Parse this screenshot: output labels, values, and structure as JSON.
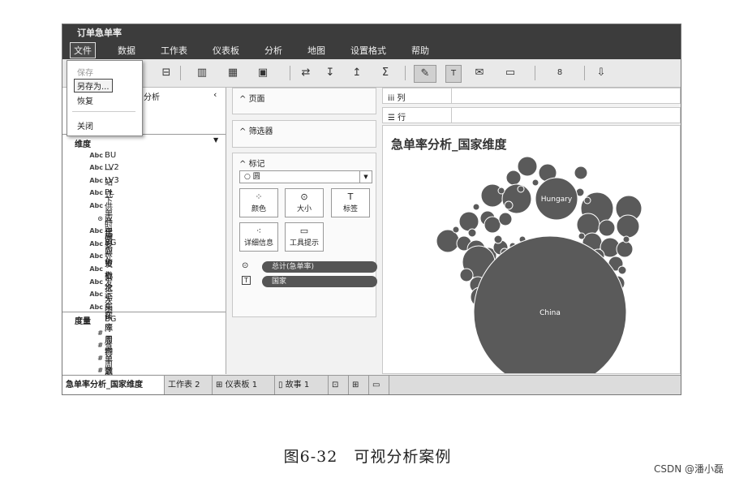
{
  "app": {
    "title": "订单急单率",
    "menus": [
      "文件",
      "数据",
      "工作表",
      "仪表板",
      "分析",
      "地图",
      "设置格式",
      "帮助"
    ]
  },
  "file_menu": {
    "items": [
      {
        "label": "保存",
        "state": "disabled"
      },
      {
        "label": "另存为...",
        "state": "highlighted"
      },
      {
        "label": "恢复",
        "state": "normal"
      },
      {
        "label": "关闭",
        "state": "normal"
      }
    ]
  },
  "toolbar": {
    "icons": [
      "datasource-icon",
      "new-sheet-icon",
      "duplicate-icon",
      "clear-icon",
      "swap-icon",
      "sort-asc-icon",
      "sort-desc-icon",
      "sum-icon",
      "highlight-icon",
      "label-icon",
      "annotate-icon",
      "fit-icon",
      "show-me-icon",
      "present-icon"
    ],
    "glyphs": [
      "⊟",
      "▥",
      "▦",
      "▣",
      "⇄",
      "↧",
      "↥",
      "Σ",
      "✎",
      "T",
      "✉",
      "▭",
      "8",
      "⇩"
    ]
  },
  "data_pane": {
    "title": "分析",
    "dimensions_header": "维度",
    "dimensions": [
      {
        "type": "Abc",
        "name": "BU"
      },
      {
        "type": "Abc",
        "name": "LV2"
      },
      {
        "type": "Abc",
        "name": "LV3"
      },
      {
        "type": "Abc",
        "name": "PL"
      },
      {
        "type": "Abc",
        "name": "一站式供应中心"
      },
      {
        "type": "⊙",
        "name": "下单时间"
      },
      {
        "type": "Abc",
        "name": "产品BG"
      },
      {
        "type": "Abc",
        "name": "代表处"
      },
      {
        "type": "Abc",
        "name": "供应中心"
      },
      {
        "type": "Abc",
        "name": "到货批次"
      },
      {
        "type": "Abc",
        "name": "发货批次"
      },
      {
        "type": "Abc",
        "name": "发运集"
      },
      {
        "type": "Abc",
        "name": "全国BG"
      }
    ],
    "measures_header": "度量",
    "measures": [
      {
        "type": "#",
        "name": "在库周期"
      },
      {
        "type": "#",
        "name": "实际履行周期"
      },
      {
        "type": "#",
        "name": "急单数"
      },
      {
        "type": "#",
        "name": "急单满足率"
      }
    ]
  },
  "cards": {
    "pages": "页面",
    "filters": "筛选器",
    "marks": "标记",
    "mark_type": "圆",
    "mark_buttons": [
      {
        "label": "颜色",
        "glyph": "⁘"
      },
      {
        "label": "大小",
        "glyph": "⊙"
      },
      {
        "label": "标签",
        "glyph": "T"
      },
      {
        "label": "详细信息",
        "glyph": "⁖"
      },
      {
        "label": "工具提示",
        "glyph": "▭"
      }
    ],
    "pills": [
      {
        "icon": "⊙",
        "label": "总计(急单率)"
      },
      {
        "icon": "T",
        "label": "国家"
      }
    ]
  },
  "shelves": {
    "columns": "列",
    "rows": "行"
  },
  "viz": {
    "title": "急单率分析_国家维度",
    "labels": [
      "China",
      "Hungary"
    ],
    "bubble_color": "#5a5a5a"
  },
  "tabs": [
    "急单率分析_国家维度",
    "工作表 2",
    "仪表板 1",
    "故事 1"
  ],
  "caption": "图6-32　可视分析案例",
  "watermark": "CSDN @潘小磊"
}
